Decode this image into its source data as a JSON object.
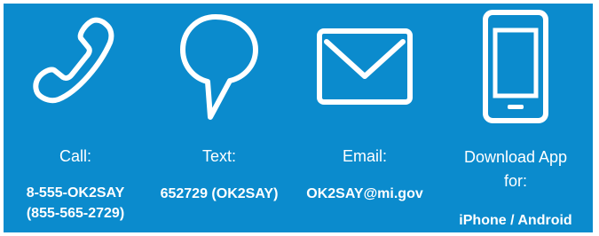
{
  "brand": {
    "background": "#0b8bcd",
    "foreground": "#ffffff"
  },
  "contacts": [
    {
      "icon": "phone-icon",
      "label": "Call:",
      "value_lines": [
        "8-555-OK2SAY",
        "(855-565-2729)"
      ]
    },
    {
      "icon": "speech-bubble-icon",
      "label": "Text:",
      "value_lines": [
        "652729 (OK2SAY)"
      ]
    },
    {
      "icon": "envelope-icon",
      "label": "Email:",
      "value_lines": [
        "OK2SAY@mi.gov"
      ]
    },
    {
      "icon": "smartphone-icon",
      "label_lines": [
        "Download App",
        "for:"
      ],
      "value_lines": [
        "iPhone / Android"
      ]
    }
  ]
}
